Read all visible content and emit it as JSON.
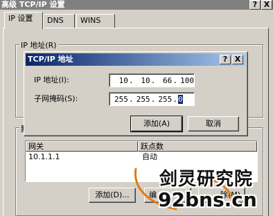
{
  "outer_window": {
    "title": "高级 TCP/IP 设置",
    "help_button": "?",
    "close_button": "X"
  },
  "tabs": [
    {
      "label": "IP 设置",
      "active": true
    },
    {
      "label": "DNS",
      "active": false
    },
    {
      "label": "WINS",
      "active": false
    }
  ],
  "ip_group": {
    "label": "IP 地址(R)"
  },
  "gateway_group": {
    "label": "默",
    "columns": [
      "网关",
      "跃点数"
    ],
    "rows": [
      {
        "gateway": "10.1.1.1",
        "metric": "自动"
      }
    ],
    "buttons": {
      "add": "添加(D)...",
      "edit": "编",
      "remove": "除(M)"
    }
  },
  "dialog": {
    "title": "TCP/IP 地址",
    "help_button": "?",
    "close_button": "X",
    "ip_label": "IP 地址(I):",
    "ip_octets": [
      "10",
      "10",
      "66",
      "100"
    ],
    "mask_label": "子网掩码(S):",
    "mask_octets": [
      "255",
      "255",
      "255",
      "0"
    ],
    "add_button": "添加(A)",
    "cancel_button": "取消"
  },
  "watermark": {
    "site_name": "剑灵研究院",
    "url": "92bns.cn"
  },
  "colors": {
    "title_active": "#0a246a",
    "title_inactive": "#808080",
    "face": "#d4d0c8",
    "selection": "#0a246a"
  }
}
